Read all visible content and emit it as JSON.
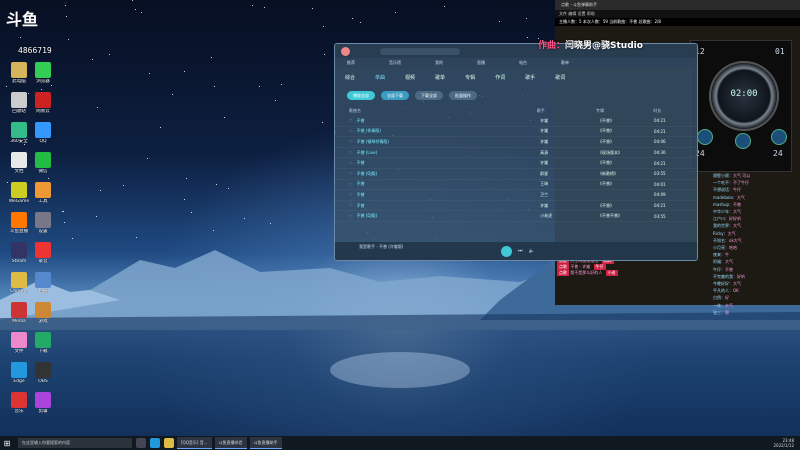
{
  "logo": {
    "text": "斗鱼",
    "room": "4866719"
  },
  "desktop_icons": [
    {
      "label": "此电脑",
      "color": "#d6b45a"
    },
    {
      "label": "回收站",
      "color": "#ccc"
    },
    {
      "label": "360安全",
      "color": "#3b8"
    },
    {
      "label": "文档",
      "color": "#e8e8e8"
    },
    {
      "label": "WeGame",
      "color": "#cc2"
    },
    {
      "label": "斗鱼直播",
      "color": "#f70"
    },
    {
      "label": "Steam",
      "color": "#336"
    },
    {
      "label": "Chrome",
      "color": "#db4"
    },
    {
      "label": "Media",
      "color": "#c33"
    },
    {
      "label": "文件",
      "color": "#e8c"
    },
    {
      "label": "Edge",
      "color": "#29d"
    },
    {
      "label": "音乐",
      "color": "#d33"
    },
    {
      "label": "浏览器",
      "color": "#3c5"
    },
    {
      "label": "网易云",
      "color": "#c22"
    },
    {
      "label": "QQ",
      "color": "#39f"
    },
    {
      "label": "微信",
      "color": "#2b4"
    },
    {
      "label": "工具",
      "color": "#e93"
    },
    {
      "label": "设置",
      "color": "#778"
    },
    {
      "label": "录音",
      "color": "#e33"
    },
    {
      "label": "相册",
      "color": "#58c"
    },
    {
      "label": "游戏",
      "color": "#c83"
    },
    {
      "label": "下载",
      "color": "#2a6"
    },
    {
      "label": "OBS",
      "color": "#333"
    },
    {
      "label": "剪辑",
      "color": "#a4d"
    }
  ],
  "music": {
    "subnav": [
      "推荐",
      "音乐馆",
      "我的",
      "直播",
      "电台",
      "歌单"
    ],
    "tabs": [
      "综合",
      "单曲",
      "视频",
      "歌单",
      "专辑",
      "作词",
      "歌手",
      "歌词"
    ],
    "active_tab": "单曲",
    "buttons": [
      "播放全部",
      "全部下载",
      "下载全部",
      "批量操作"
    ],
    "headers": [
      "歌曲名",
      "歌手",
      "专辑",
      "时长"
    ],
    "songs": [
      {
        "title": "不曾",
        "artist": "许嵩",
        "album": "《不曾》",
        "dur": "04:21"
      },
      {
        "title": "不曾 (伴奏版)",
        "artist": "许嵩",
        "album": "《不曾》",
        "dur": "04:21"
      },
      {
        "title": "不曾 (钢琴抒情版)",
        "artist": "许嵩",
        "album": "《不曾》",
        "dur": "04:06"
      },
      {
        "title": "不曾 (Live)",
        "artist": "高清",
        "album": "《现场版本》",
        "dur": "04:30"
      },
      {
        "title": "不曾",
        "artist": "许嵩",
        "album": "《不曾》",
        "dur": "04:21"
      },
      {
        "title": "不曾 (DJ版)",
        "artist": "群星",
        "album": "《新歌榜》",
        "dur": "03:55"
      },
      {
        "title": "不曾",
        "artist": "王琦",
        "album": "《不曾》",
        "dur": "04:01"
      },
      {
        "title": "不曾",
        "artist": "卫兰",
        "album": "",
        "dur": "04:09"
      },
      {
        "title": "不曾",
        "artist": "许嵩",
        "album": "《不曾》",
        "dur": "04:21"
      },
      {
        "title": "不曾 (DJ版)",
        "artist": "小老虎",
        "album": "《不曾不曾》",
        "dur": "03:55"
      }
    ],
    "now_playing": "我是歌手 - 不曾 (许嵩版)"
  },
  "overlay": {
    "prefix": "作曲：",
    "name": "闫晓男@骁Studio"
  },
  "clock": {
    "time": "02:00",
    "left_num": "12",
    "right_num": "01",
    "bottom_left": "24",
    "bottom_right": "24"
  },
  "chat": [
    {
      "u": "隔壁小顾",
      "m": "大气 可以"
    },
    {
      "u": "一个吃不",
      "m": "不了牛仔"
    },
    {
      "u": "不想说话",
      "m": "牛仔"
    },
    {
      "u": "madebolo",
      "m": "大气"
    },
    {
      "u": "mashup",
      "m": "不曾"
    },
    {
      "u": "中华少年",
      "m": "大气"
    },
    {
      "u": "江户川",
      "m": "好好听"
    },
    {
      "u": "我的世界",
      "m": "大气"
    },
    {
      "u": "Ricky",
      "m": "大气"
    },
    {
      "u": "不知名",
      "m": "ok大气"
    },
    {
      "u": "小月亮",
      "m": "哈哈"
    },
    {
      "u": "夜来",
      "m": "牛"
    },
    {
      "u": "阿福",
      "m": "大气"
    },
    {
      "u": "牛仔",
      "m": "不曾"
    },
    {
      "u": "不完美的我",
      "m": "好听"
    },
    {
      "u": "今晚好好",
      "m": "大气"
    },
    {
      "u": "平凡的人",
      "m": "OK"
    },
    {
      "u": "白鸽",
      "m": "好"
    },
    {
      "u": "一休",
      "m": "大气"
    },
    {
      "u": "张三",
      "m": "稳"
    }
  ],
  "rtitle": "点歌 - 斗鱼弹幕助手",
  "rinfo": "主播人数：5  本次人数：59  当前歌曲：不曾  总歌曲：2/8",
  "taskbar": {
    "search": "在这里输入你要搜索的内容",
    "apps": [
      "[QQ音乐] 音...",
      "斗鱼直播伴侣",
      "斗鱼直播助手"
    ],
    "time": "23:48",
    "date": "2022/1/12"
  }
}
